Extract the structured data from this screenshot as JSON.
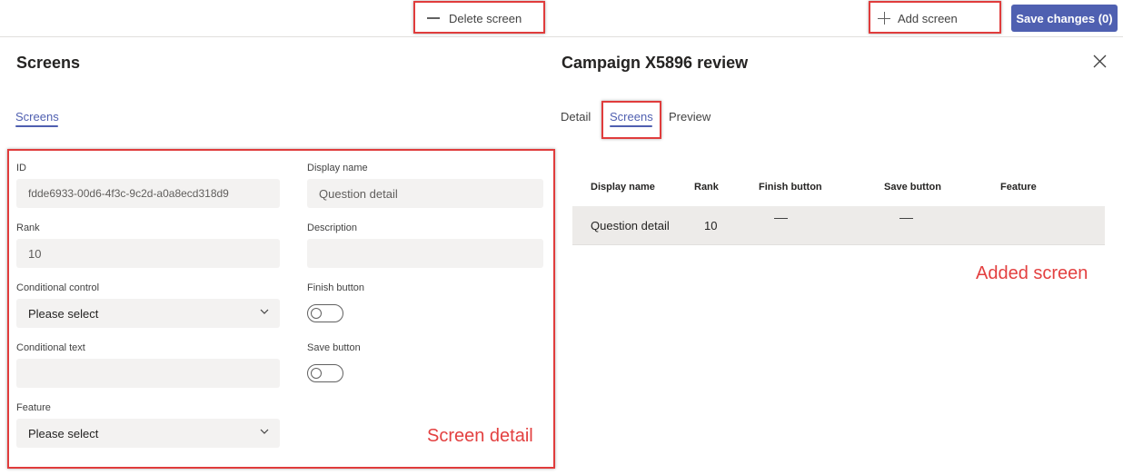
{
  "toolbar": {
    "delete_label": "Delete screen",
    "add_label": "Add screen",
    "save_label": "Save changes (0)"
  },
  "left_panel": {
    "title": "Screens",
    "tab_label": "Screens",
    "fields": {
      "id_label": "ID",
      "id_value": "fdde6933-00d6-4f3c-9c2d-a0a8ecd318d9",
      "display_name_label": "Display name",
      "display_name_value": "Question detail",
      "rank_label": "Rank",
      "rank_value": "10",
      "description_label": "Description",
      "description_value": "",
      "conditional_control_label": "Conditional control",
      "conditional_control_value": "Please select",
      "finish_button_label": "Finish button",
      "conditional_text_label": "Conditional text",
      "conditional_text_value": "",
      "save_button_label": "Save button",
      "feature_label": "Feature",
      "feature_value": "Please select"
    },
    "annotation": "Screen detail"
  },
  "right_panel": {
    "title": "Campaign X5896 review",
    "tabs": [
      "Detail",
      "Screens",
      "Preview"
    ],
    "active_tab": "Screens",
    "table": {
      "headers": [
        "Display name",
        "Rank",
        "Finish button",
        "Save button",
        "Feature"
      ],
      "rows": [
        {
          "display_name": "Question detail",
          "rank": "10",
          "finish_button": "—",
          "save_button": "—",
          "feature": ""
        }
      ]
    },
    "annotation": "Added screen"
  },
  "colors": {
    "accent": "#4f60b1",
    "annotation_red": "#e03c3c",
    "field_bg": "#f3f2f1"
  },
  "icons": {
    "delete": "minus-icon",
    "add": "plus-icon",
    "close": "close-icon",
    "dropdown": "chevron-down-icon"
  }
}
